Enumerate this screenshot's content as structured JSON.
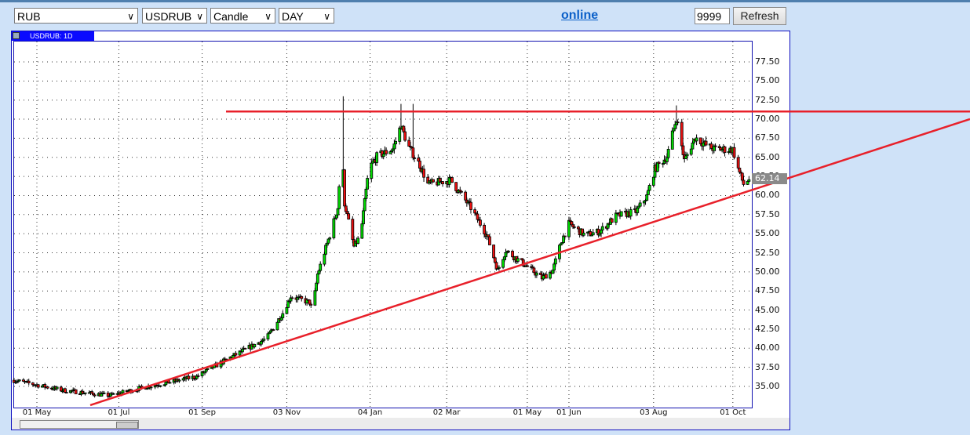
{
  "toolbar": {
    "currency_select": "RUB",
    "symbol_select": "USDRUB",
    "chart_type_select": "Candle",
    "period_select": "DAY",
    "online_link": "online",
    "bars_count": "9999",
    "refresh_label": "Refresh"
  },
  "chart_data": {
    "type": "candlestick",
    "title": "USDRUB: 1D",
    "last_price": "62.14",
    "y_ticks": [
      "77.50",
      "75.00",
      "72.50",
      "70.00",
      "67.50",
      "65.00",
      "62.50",
      "60.00",
      "57.50",
      "55.00",
      "52.50",
      "50.00",
      "47.50",
      "45.00",
      "42.50",
      "40.00",
      "37.50",
      "35.00"
    ],
    "ylim": [
      32.5,
      80.0
    ],
    "x_ticks": [
      {
        "label": "01 May",
        "day": 0
      },
      {
        "label": "01 Jul",
        "day": 61
      },
      {
        "label": "01 Sep",
        "day": 123
      },
      {
        "label": "03 Nov",
        "day": 186
      },
      {
        "label": "04 Jan",
        "day": 248
      },
      {
        "label": "02 Mar",
        "day": 305
      },
      {
        "label": "01 May",
        "day": 365
      },
      {
        "label": "01 Jun",
        "day": 396
      },
      {
        "label": "03 Aug",
        "day": 459
      },
      {
        "label": "01 Oct",
        "day": 518
      }
    ],
    "approx_close_path": [
      [
        -17,
        35.8
      ],
      [
        19,
        34.5
      ],
      [
        54,
        33.8
      ],
      [
        78,
        34.8
      ],
      [
        119,
        36.3
      ],
      [
        142,
        38.6
      ],
      [
        171,
        41.3
      ],
      [
        183,
        44.6
      ],
      [
        189,
        46.8
      ],
      [
        203,
        46.0
      ],
      [
        205,
        44.8
      ],
      [
        209,
        49.7
      ],
      [
        218,
        54.8
      ],
      [
        224,
        58.4
      ],
      [
        227,
        67.0
      ],
      [
        229,
        59.0
      ],
      [
        236,
        53.3
      ],
      [
        241,
        54.8
      ],
      [
        247,
        63.5
      ],
      [
        253,
        65.1
      ],
      [
        265,
        66.1
      ],
      [
        271,
        69.2
      ],
      [
        276,
        66.6
      ],
      [
        285,
        64.0
      ],
      [
        291,
        61.5
      ],
      [
        308,
        62.0
      ],
      [
        323,
        58.4
      ],
      [
        335,
        54.8
      ],
      [
        343,
        50.2
      ],
      [
        349,
        52.8
      ],
      [
        361,
        51.2
      ],
      [
        376,
        49.2
      ],
      [
        384,
        50.2
      ],
      [
        390,
        53.8
      ],
      [
        396,
        56.3
      ],
      [
        408,
        54.8
      ],
      [
        419,
        55.3
      ],
      [
        431,
        57.3
      ],
      [
        446,
        57.9
      ],
      [
        454,
        59.9
      ],
      [
        460,
        63.5
      ],
      [
        469,
        65.1
      ],
      [
        476,
        70.2
      ],
      [
        482,
        64.6
      ],
      [
        490,
        67.6
      ],
      [
        498,
        66.6
      ],
      [
        504,
        66.1
      ],
      [
        518,
        66.0
      ],
      [
        522,
        63.5
      ],
      [
        526,
        61.5
      ],
      [
        530,
        62.14
      ]
    ],
    "annotations": {
      "resistance_level": 71.0,
      "support_trendline": [
        [
          39,
          32.5
        ],
        [
          530,
          60.6
        ]
      ]
    },
    "colors": {
      "up": "#00dd00",
      "down": "#ee1111",
      "lines": "#e8202a"
    }
  }
}
